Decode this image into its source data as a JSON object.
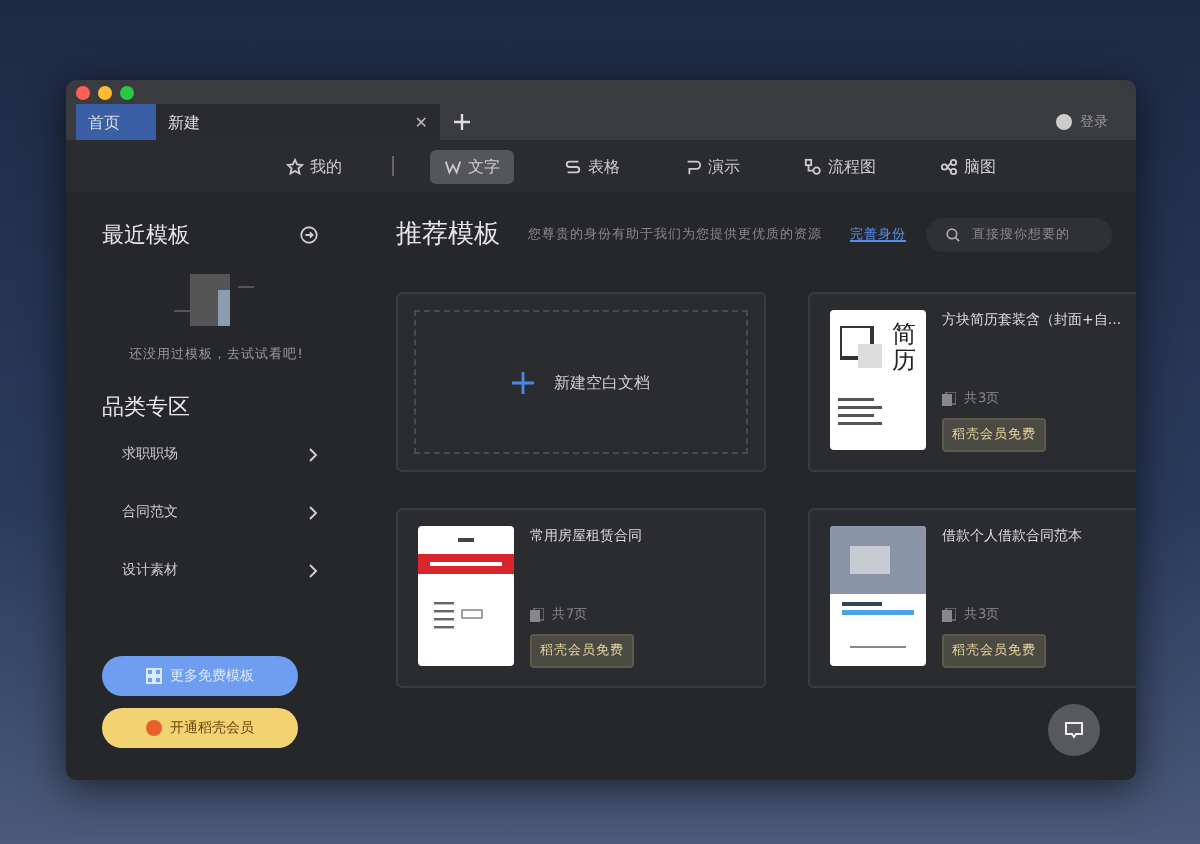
{
  "tabs": [
    {
      "label": "首页",
      "selected": true
    },
    {
      "label": "新建",
      "selected": false,
      "close": "✕"
    }
  ],
  "account": {
    "name": "登录"
  },
  "nav": [
    {
      "label": "我的",
      "selected": false
    },
    {
      "label": "文字",
      "selected": true
    },
    {
      "label": "表格",
      "selected": false
    },
    {
      "label": "演示",
      "selected": false
    },
    {
      "label": "流程图",
      "selected": false
    },
    {
      "label": "脑图",
      "selected": false
    }
  ],
  "sidebar": {
    "recent_title": "最近模板",
    "empty_hint": "还没用过模板，去试试看吧!",
    "category_title": "品类专区",
    "categories": [
      "求职职场",
      "合同范文",
      "设计素材"
    ],
    "buttons": [
      {
        "label": "更多免费模板",
        "kind": "blue"
      },
      {
        "label": "开通稻壳会员",
        "kind": "gold"
      }
    ]
  },
  "main": {
    "title": "推荐模板",
    "subtitle": "您尊贵的身份有助于我们为您提供更优质的资源",
    "link": "完善身份",
    "search": {
      "placeholder": "直接搜你想要的"
    },
    "new_doc": "新建空白文档",
    "templates": [
      {
        "title": "方块简历套装含（封面+自...",
        "pages": "共3页",
        "badge": "稻壳会员免费",
        "kind": "resume",
        "thumb_text": "简历"
      },
      {
        "title": "常用房屋租赁合同",
        "pages": "共7页",
        "badge": "稻壳会员免费",
        "kind": "contract"
      },
      {
        "title": "借款个人借款合同范本",
        "pages": "共3页",
        "badge": "稻壳会员免费",
        "kind": "photo"
      }
    ]
  }
}
